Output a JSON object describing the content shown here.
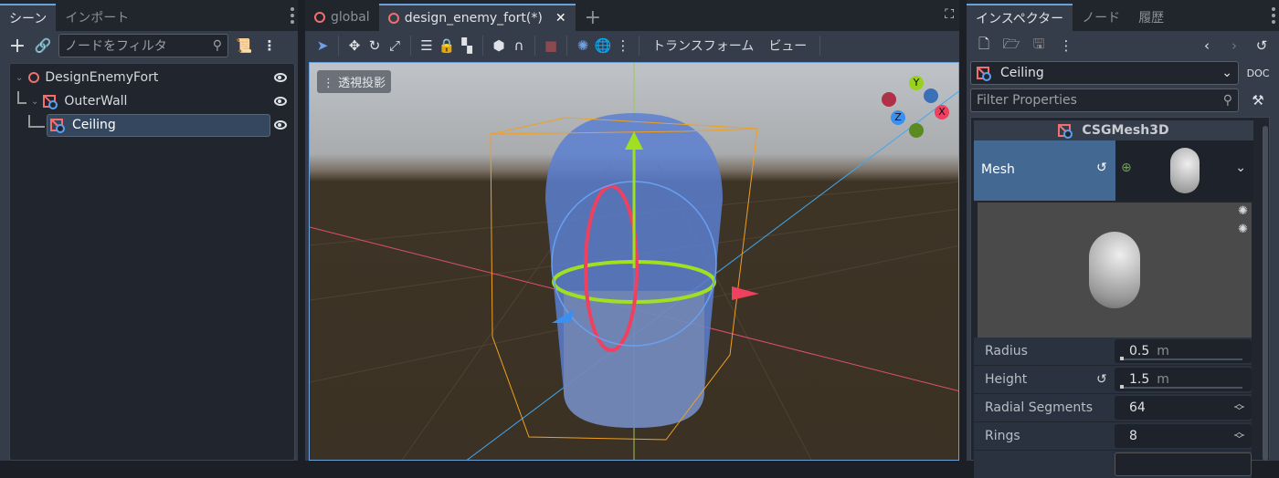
{
  "scene_panel": {
    "tabs": [
      "シーン",
      "インポート"
    ],
    "filter_placeholder": "ノードをフィルタ",
    "tree": [
      {
        "name": "DesignEnemyFort",
        "icon": "node3d-icon"
      },
      {
        "name": "OuterWall",
        "icon": "csg-icon"
      },
      {
        "name": "Ceiling",
        "icon": "csg-icon",
        "selected": true
      }
    ]
  },
  "editor": {
    "tabs": [
      {
        "label": "global"
      },
      {
        "label": "design_enemy_fort(*)",
        "active": true
      }
    ],
    "toolbar": {
      "transform_menu": "トランスフォーム",
      "view_menu": "ビュー"
    },
    "viewport": {
      "projection_label": "透視投影",
      "gizmo_axes": [
        "X",
        "Y",
        "Z"
      ]
    }
  },
  "inspector": {
    "tabs": [
      "インスペクター",
      "ノード",
      "履歴"
    ],
    "selected_node": "Ceiling",
    "filter_placeholder": "Filter Properties",
    "section": "CSGMesh3D",
    "mesh_label": "Mesh",
    "properties": [
      {
        "label": "Radius",
        "value": "0.5",
        "unit": "m"
      },
      {
        "label": "Height",
        "value": "1.5",
        "unit": "m"
      },
      {
        "label": "Radial Segments",
        "value": "64"
      },
      {
        "label": "Rings",
        "value": "8"
      }
    ]
  },
  "colors": {
    "accent": "#6ea0d8",
    "panel": "#363d4a",
    "node_red": "#f07070"
  }
}
